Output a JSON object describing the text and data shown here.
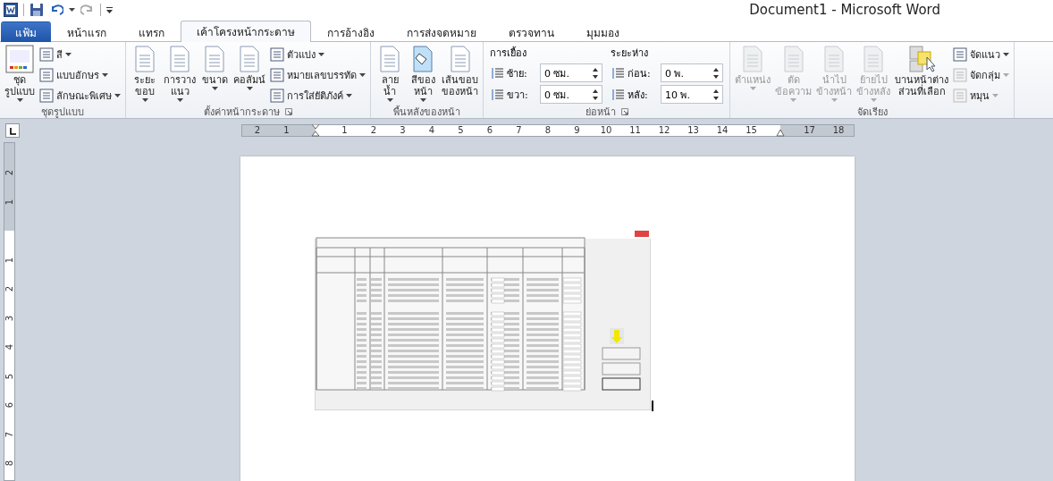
{
  "window": {
    "title": "Document1 - Microsoft Word"
  },
  "tabs": [
    {
      "label": "แฟ้ม",
      "kind": "file",
      "selected": false
    },
    {
      "label": "หน้าแรก",
      "kind": "tab",
      "selected": false
    },
    {
      "label": "แทรก",
      "kind": "tab",
      "selected": false
    },
    {
      "label": "เค้าโครงหน้ากระดาษ",
      "kind": "tab",
      "selected": true
    },
    {
      "label": "การอ้างอิง",
      "kind": "tab",
      "selected": false
    },
    {
      "label": "การส่งจดหมาย",
      "kind": "tab",
      "selected": false
    },
    {
      "label": "ตรวจทาน",
      "kind": "tab",
      "selected": false
    },
    {
      "label": "มุมมอง",
      "kind": "tab",
      "selected": false
    }
  ],
  "ribbon": {
    "groups": [
      {
        "label": "ชุดรูปแบบ",
        "launcher": false,
        "items": [
          {
            "kind": "big",
            "label": "ชุด\nรูปแบบ",
            "dropdown": true,
            "disabled": false
          },
          {
            "kind": "stack",
            "items": [
              {
                "label": "สี",
                "dropdown": true,
                "disabled": false
              },
              {
                "label": "แบบอักษร",
                "dropdown": true,
                "disabled": false
              },
              {
                "label": "ลักษณะพิเศษ",
                "dropdown": true,
                "disabled": false
              }
            ]
          }
        ]
      },
      {
        "label": "ตั้งค่าหน้ากระดาษ",
        "launcher": true,
        "items": [
          {
            "kind": "big",
            "label": "ระยะ\nขอบ",
            "dropdown": true,
            "disabled": false
          },
          {
            "kind": "big",
            "label": "การวาง\nแนว",
            "dropdown": true,
            "disabled": false
          },
          {
            "kind": "big",
            "label": "ขนาด",
            "dropdown": true,
            "disabled": false
          },
          {
            "kind": "big",
            "label": "คอลัมน์",
            "dropdown": true,
            "disabled": false
          },
          {
            "kind": "stack",
            "items": [
              {
                "label": "ตัวแบ่ง",
                "dropdown": true,
                "disabled": false
              },
              {
                "label": "หมายเลขบรรทัด",
                "dropdown": true,
                "disabled": false
              },
              {
                "label": "การใส่ยัติภังค์",
                "dropdown": true,
                "disabled": false
              }
            ]
          }
        ]
      },
      {
        "label": "พื้นหลังของหน้า",
        "launcher": false,
        "items": [
          {
            "kind": "big",
            "label": "ลาย\nน้ำ",
            "dropdown": true,
            "disabled": false
          },
          {
            "kind": "big",
            "label": "สีของ\nหน้า",
            "dropdown": true,
            "disabled": false
          },
          {
            "kind": "big",
            "label": "เส้นขอบ\nของหน้า",
            "dropdown": false,
            "disabled": false
          }
        ]
      },
      {
        "label": "ย่อหน้า",
        "launcher": true,
        "items": [
          {
            "kind": "spins",
            "heading": "การเยื้อง",
            "fields": [
              {
                "label": "ซ้าย:",
                "value": "0 ซม."
              },
              {
                "label": "ขวา:",
                "value": "0 ซม."
              }
            ]
          },
          {
            "kind": "spins",
            "heading": "ระยะห่าง",
            "fields": [
              {
                "label": "ก่อน:",
                "value": "0 พ."
              },
              {
                "label": "หลัง:",
                "value": "10 พ."
              }
            ]
          }
        ]
      },
      {
        "label": "จัดเรียง",
        "launcher": false,
        "items": [
          {
            "kind": "big",
            "label": "ตำแหน่ง",
            "dropdown": true,
            "disabled": true
          },
          {
            "kind": "big",
            "label": "ตัด\nข้อความ",
            "dropdown": true,
            "disabled": true
          },
          {
            "kind": "big",
            "label": "นำไป\nข้างหน้า",
            "dropdown": true,
            "disabled": true
          },
          {
            "kind": "big",
            "label": "ย้ายไป\nข้างหลัง",
            "dropdown": true,
            "disabled": true
          },
          {
            "kind": "big",
            "label": "บานหน้าต่าง\nส่วนที่เลือก",
            "dropdown": false,
            "disabled": false
          },
          {
            "kind": "stack",
            "items": [
              {
                "label": "จัดแนว",
                "dropdown": true,
                "disabled": false
              },
              {
                "label": "จัดกลุ่ม",
                "dropdown": true,
                "disabled": true
              },
              {
                "label": "หมุน",
                "dropdown": true,
                "disabled": true
              }
            ]
          }
        ]
      }
    ]
  },
  "ruler": {
    "left_labels": [
      "2",
      "1"
    ],
    "labels": [
      "1",
      "2",
      "3",
      "4",
      "5",
      "6",
      "7",
      "8",
      "9",
      "10",
      "11",
      "12",
      "13",
      "14",
      "15",
      "17",
      "18"
    ]
  },
  "vertical_ruler": {
    "top_labels": [
      "2",
      "1"
    ],
    "labels": [
      "1",
      "2",
      "3",
      "4",
      "5",
      "6",
      "7",
      "8"
    ]
  },
  "document": {
    "embedded_image": {
      "kind": "screenshot"
    }
  }
}
